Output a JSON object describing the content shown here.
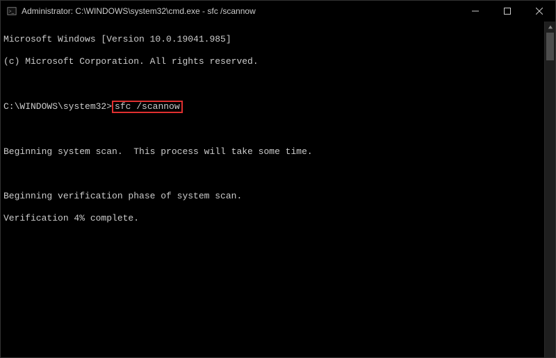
{
  "titlebar": {
    "title": "Administrator: C:\\WINDOWS\\system32\\cmd.exe - sfc  /scannow"
  },
  "terminal": {
    "version_line": "Microsoft Windows [Version 10.0.19041.985]",
    "copyright_line": "(c) Microsoft Corporation. All rights reserved.",
    "prompt": "C:\\WINDOWS\\system32>",
    "command": "sfc /scannow",
    "scan_line": "Beginning system scan.  This process will take some time.",
    "verify_phase_line": "Beginning verification phase of system scan.",
    "verify_progress_line": "Verification 4% complete."
  }
}
